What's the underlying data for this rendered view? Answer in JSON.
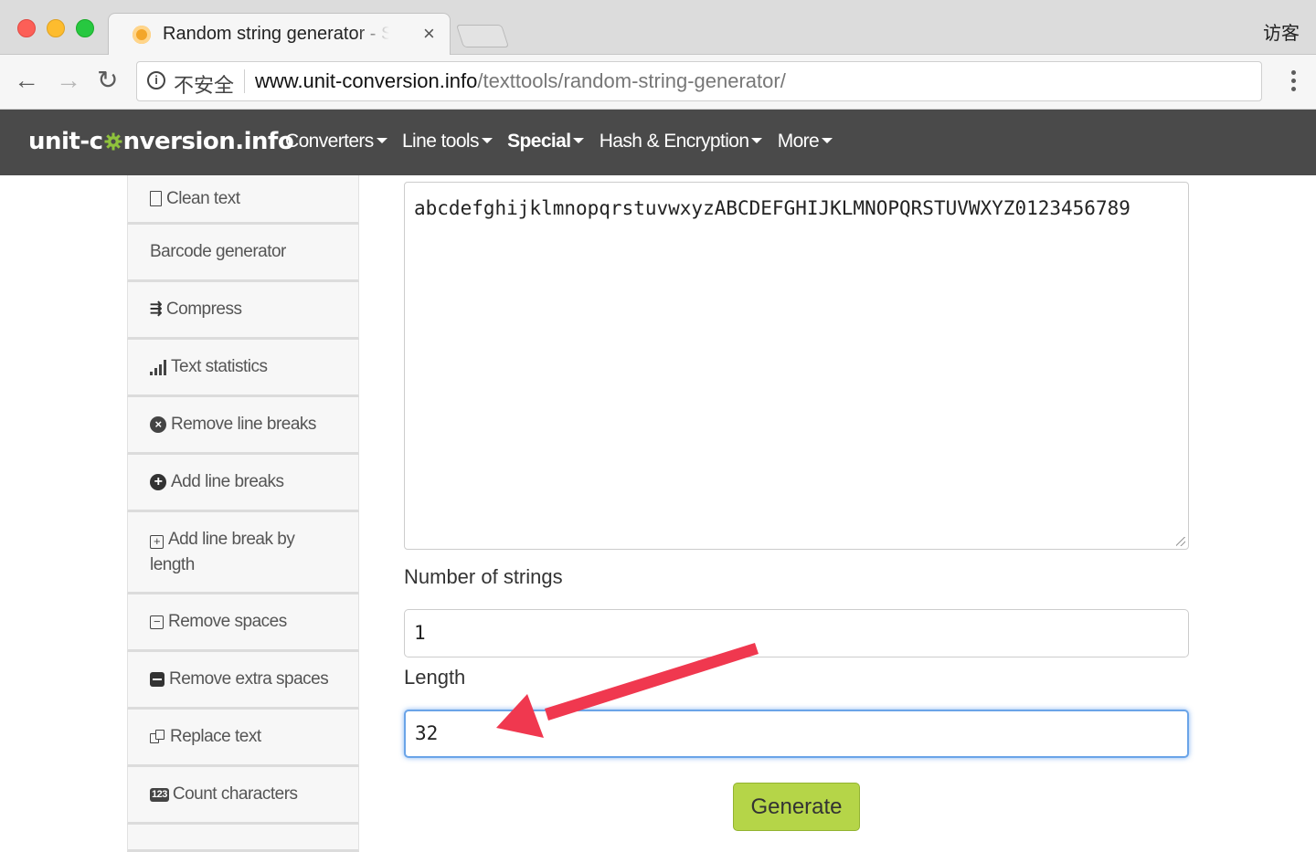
{
  "browser": {
    "tab_title": "Random string generator - Special",
    "tab_close": "×",
    "profile_label": "访客",
    "security_label": "不安全",
    "info_icon": "i",
    "url_host": "www.unit-conversion.info",
    "url_path": "/texttools/random-string-generator/",
    "back_icon": "←",
    "forward_icon": "→",
    "reload_icon": "↻"
  },
  "site": {
    "logo_prefix": "unit-c",
    "logo_suffix": "nversion.info",
    "menu": [
      {
        "label": "Converters"
      },
      {
        "label": "Line tools"
      },
      {
        "label": "Special",
        "active": true
      },
      {
        "label": "Hash & Encryption"
      },
      {
        "label": "More"
      }
    ]
  },
  "sidebar": {
    "items": [
      {
        "label": "Clean text",
        "icon": "document-icon"
      },
      {
        "label": "Barcode generator",
        "icon": ""
      },
      {
        "label": "Compress",
        "icon": "compress-icon"
      },
      {
        "label": "Text statistics",
        "icon": "bar-chart-icon"
      },
      {
        "label": "Remove line breaks",
        "icon": "circle-x-icon"
      },
      {
        "label": "Add line breaks",
        "icon": "circle-plus-icon"
      },
      {
        "label": "Add line break by length",
        "icon": "square-plus-icon"
      },
      {
        "label": "Remove spaces",
        "icon": "square-minus-icon"
      },
      {
        "label": "Remove extra spaces",
        "icon": "filled-minus-icon"
      },
      {
        "label": "Replace text",
        "icon": "copy-icon"
      },
      {
        "label": "Count characters",
        "icon": "123-icon"
      }
    ],
    "icon_glyphs": {
      "circle_x": "×",
      "circle_plus": "+",
      "square_plus": "+",
      "square_minus": "−",
      "compress": "⇶",
      "numbers": "123"
    }
  },
  "main": {
    "output_text": "abcdefghijklmnopqrstuvwxyzABCDEFGHIJKLMNOPQRSTUVWXYZ0123456789",
    "number_label": "Number of strings",
    "number_value": "1",
    "length_label": "Length",
    "length_value": "32",
    "generate_label": "Generate"
  },
  "colors": {
    "navbar": "#4a4a4a",
    "generate_button": "#b5d548",
    "annotation_arrow": "#f0384f",
    "focus_ring": "#6aa4e8"
  }
}
